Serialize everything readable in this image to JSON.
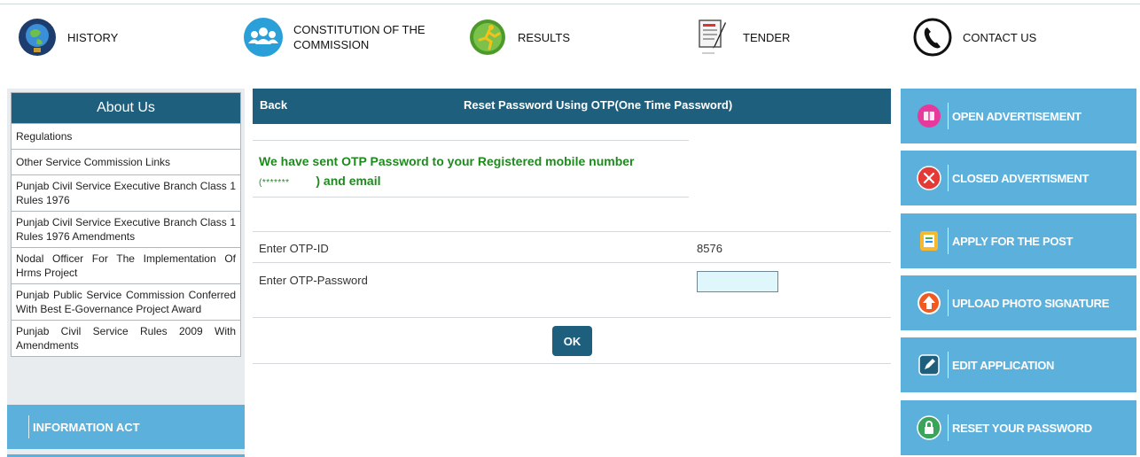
{
  "nav": {
    "items": [
      {
        "label": "HISTORY",
        "icon": "globe-icon"
      },
      {
        "label": "CONSTITUTION OF THE COMMISSION",
        "icon": "people-icon"
      },
      {
        "label": "RESULTS",
        "icon": "runner-icon"
      },
      {
        "label": "TENDER",
        "icon": "document-pen-icon"
      },
      {
        "label": "CONTACT US",
        "icon": "phone-icon"
      }
    ]
  },
  "about": {
    "title": "About Us",
    "items": [
      "Regulations",
      "Other Service Commission Links",
      "Punjab Civil Service Executive Branch Class 1 Rules 1976",
      "Punjab Civil Service Executive Branch Class 1 Rules 1976 Amendments",
      "Nodal Officer For The Implementation Of Hrms Project",
      "Punjab Public Service Commission Conferred With Best E-Governance Project Award",
      "Punjab Civil Service Rules 2009 With Amendments"
    ]
  },
  "information_act": "INFORMATION ACT",
  "main": {
    "back": "Back",
    "title": "Reset Password Using OTP(One Time Password)",
    "message_line1": "We have sent OTP Password to your Registered mobile number",
    "message_masked": "(*******",
    "message_line2": ") and email",
    "otp_id_label": "Enter OTP-ID",
    "otp_id_value": "8576",
    "otp_password_label": "Enter OTP-Password",
    "otp_password_value": "",
    "ok": "OK"
  },
  "right_menu": [
    {
      "label": "OPEN ADVERTISEMENT",
      "icon": "book-icon"
    },
    {
      "label": "CLOSED ADVERTISMENT",
      "icon": "close-circle-icon"
    },
    {
      "label": "APPLY FOR THE POST",
      "icon": "form-icon"
    },
    {
      "label": "UPLOAD PHOTO SIGNATURE",
      "icon": "upload-arrow-icon"
    },
    {
      "label": "EDIT APPLICATION",
      "icon": "edit-icon"
    },
    {
      "label": "RESET YOUR PASSWORD",
      "icon": "lock-icon"
    }
  ],
  "colors": {
    "header_blue": "#1d5f7c",
    "menu_blue": "#5cb0dc",
    "message_green": "#1e8a1e",
    "input_bg": "#dff6fb"
  }
}
